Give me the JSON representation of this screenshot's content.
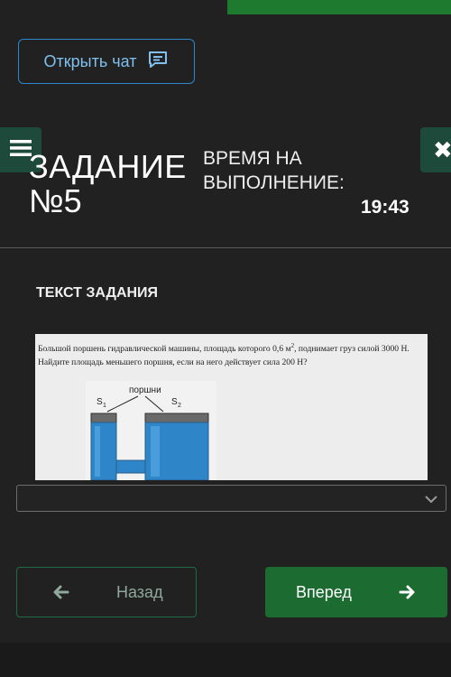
{
  "header": {
    "chat_button_label": "Открыть чат",
    "chat_icon": "chat-bubble-icon",
    "menu_icon": "hamburger-menu-icon",
    "close_icon": "close-icon",
    "close_glyph": "✖"
  },
  "task": {
    "title_line1": "ЗАДАНИЕ",
    "title_line2": "№5",
    "time_label_line1": "ВРЕМЯ НА",
    "time_label_line2": "ВЫПОЛНЕНИЕ:",
    "time_value": "19:43",
    "section_title": "ТЕКСТ ЗАДАНИЯ",
    "text_part1": "Большой поршень гидравлической машины, площадь которого 0,6 м",
    "text_sup": "2",
    "text_part2": ", поднимает груз силой 3000 Н. Найдите площадь меньшего поршня, если на него действует сила 200 Н?",
    "diagram": {
      "label_pistons": "поршни",
      "label_s1": "S",
      "label_s1_sub": "1",
      "label_s2": "S",
      "label_s2_sub": "2"
    }
  },
  "answer": {
    "select_value": "",
    "chevron_icon": "chevron-down-icon"
  },
  "nav": {
    "back_label": "Назад",
    "forward_label": "Вперед",
    "back_icon": "arrow-left-icon",
    "forward_icon": "arrow-right-icon"
  },
  "colors": {
    "background": "#212121",
    "accent_green": "#1c6b31",
    "chat_border": "#2f86c9",
    "chat_text": "#7fc0ee"
  }
}
